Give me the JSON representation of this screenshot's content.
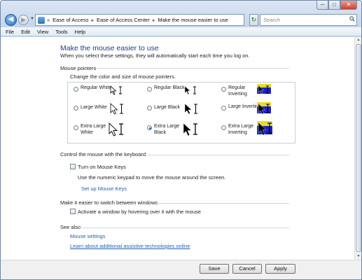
{
  "window": {
    "controls": {
      "minimize": "─",
      "maximize": "□",
      "close": "✕"
    }
  },
  "address": {
    "overflow": "«",
    "crumbs": [
      "Ease of Access",
      "Ease of Access Center",
      "Make the mouse easier to use"
    ],
    "separator": "▸",
    "dropdown": "▼",
    "refresh": "↻",
    "search_placeholder": "Search"
  },
  "nav": {
    "back": "◀",
    "forward": "▶",
    "history": "▼"
  },
  "menu": [
    "File",
    "Edit",
    "View",
    "Tools",
    "Help"
  ],
  "page": {
    "title": "Make the mouse easier to use",
    "subtitle": "When you select these settings, they will automatically start each time you log on."
  },
  "pointers_section": {
    "heading": "Mouse pointers",
    "description": "Change the color and size of mouse pointers.",
    "options": [
      {
        "label": "Regular White",
        "checked": false
      },
      {
        "label": "Regular Black",
        "checked": false
      },
      {
        "label": "Regular Inverting",
        "checked": false
      },
      {
        "label": "Large White",
        "checked": false
      },
      {
        "label": "Large Black",
        "checked": false
      },
      {
        "label": "Large Inverting",
        "checked": false
      },
      {
        "label": "Extra Large White",
        "checked": false
      },
      {
        "label": "Extra Large Black",
        "checked": true
      },
      {
        "label": "Extra Large Inverting",
        "checked": false
      }
    ]
  },
  "keyboard_section": {
    "heading": "Control the mouse with the keyboard",
    "checkbox_label": "Turn on Mouse Keys",
    "checked": false,
    "description": "Use the numeric keypad to move the mouse around the screen.",
    "link": "Set up Mouse Keys"
  },
  "windows_section": {
    "heading": "Make it easier to switch between windows",
    "checkbox_label": "Activate a window by hovering over it with the mouse",
    "checked": false
  },
  "see_also": {
    "heading": "See also",
    "links": [
      "Mouse settings",
      "Learn about additional assistive technologies online"
    ]
  },
  "buttons": {
    "save": "Save",
    "cancel": "Cancel",
    "apply": "Apply"
  },
  "colors": {
    "title": "#1e3d8a",
    "link": "#1f5fb5",
    "selected_radio": "#2a62b8",
    "inverting_fill": "#1b22c8",
    "inverting_top": "#e6dd1f"
  }
}
